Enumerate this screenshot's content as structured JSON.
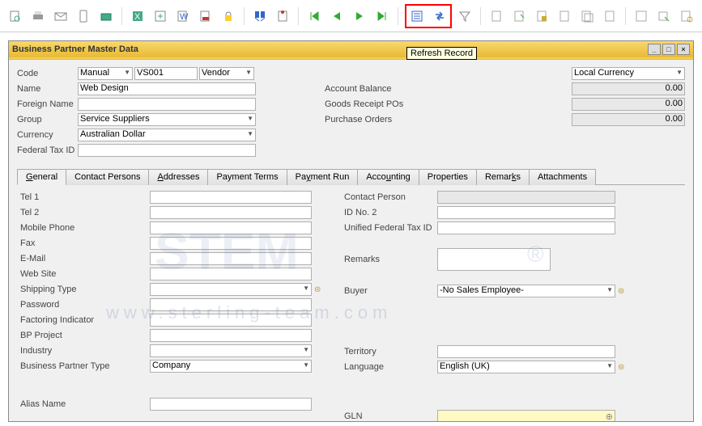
{
  "tooltip": "Refresh Record",
  "window": {
    "title": "Business Partner Master Data"
  },
  "header": {
    "code_label": "Code",
    "code_mode": "Manual",
    "code_value": "VS001",
    "code_type": "Vendor",
    "name_label": "Name",
    "name_value": "Web Design",
    "fname_label": "Foreign Name",
    "fname_value": "",
    "group_label": "Group",
    "group_value": "Service Suppliers",
    "currency_label": "Currency",
    "currency_value": "Australian Dollar",
    "taxid_label": "Federal Tax ID",
    "taxid_value": "",
    "local_currency": "Local Currency",
    "acct_bal_label": "Account Balance",
    "acct_bal_value": "0.00",
    "grpo_label": "Goods Receipt POs",
    "grpo_value": "0.00",
    "po_label": "Purchase Orders",
    "po_value": "0.00"
  },
  "tabs": {
    "general": "General",
    "contact": "Contact Persons",
    "addresses": "Addresses",
    "payterms": "Payment Terms",
    "payrun": "Payment Run",
    "accounting": "Accounting",
    "properties": "Properties",
    "remarks": "Remarks",
    "attachments": "Attachments"
  },
  "general": {
    "tel1": "Tel 1",
    "tel2": "Tel 2",
    "mobile": "Mobile Phone",
    "fax": "Fax",
    "email": "E-Mail",
    "website": "Web Site",
    "shiptype": "Shipping Type",
    "password": "Password",
    "factoring": "Factoring Indicator",
    "bpproject": "BP Project",
    "industry": "Industry",
    "bptype_label": "Business Partner Type",
    "bptype_value": "Company",
    "alias": "Alias Name",
    "contact_person": "Contact Person",
    "idno2": "ID No. 2",
    "uftid": "Unified Federal Tax ID",
    "remarks": "Remarks",
    "buyer_label": "Buyer",
    "buyer_value": "-No Sales Employee-",
    "territory": "Territory",
    "language_label": "Language",
    "language_value": "English (UK)",
    "gln": "GLN"
  }
}
